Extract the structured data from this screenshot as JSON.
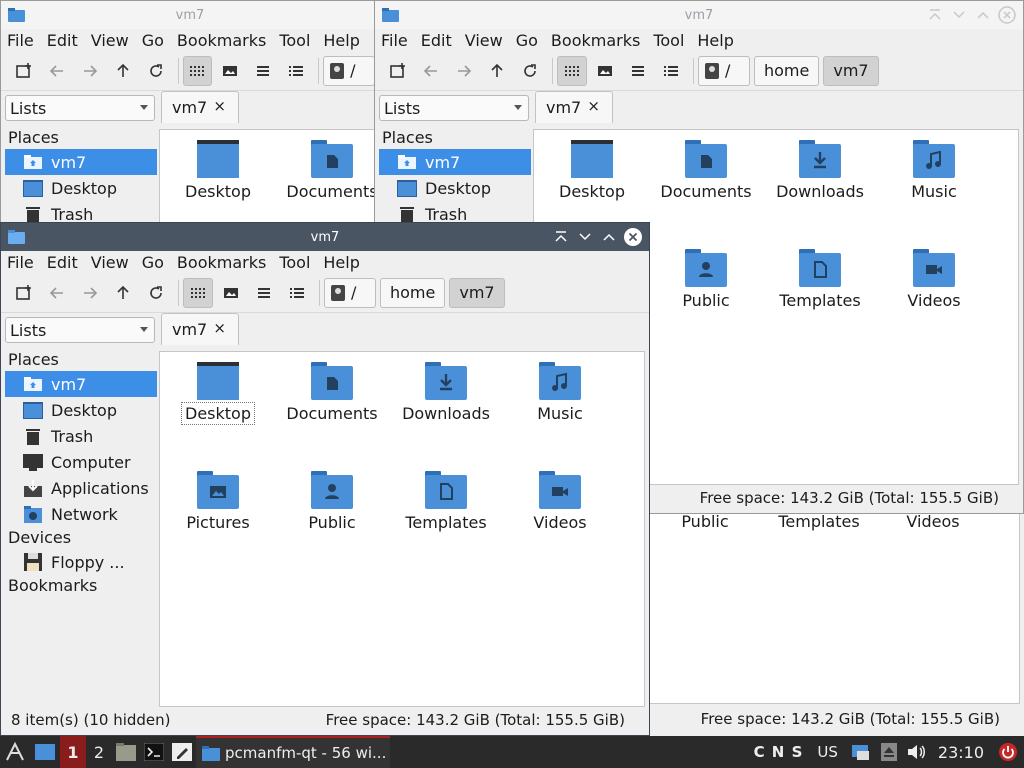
{
  "menu": [
    "File",
    "Edit",
    "View",
    "Go",
    "Bookmarks",
    "Tool",
    "Help"
  ],
  "breadcrumb": {
    "root": "/",
    "home": "home",
    "current": "vm7"
  },
  "side": {
    "combo": "Lists",
    "places_header": "Places",
    "devices_header": "Devices",
    "bookmarks_header": "Bookmarks",
    "places": [
      {
        "label": "vm7",
        "icon": "home-folder-icon"
      },
      {
        "label": "Desktop",
        "icon": "desktop-icon"
      },
      {
        "label": "Trash",
        "icon": "trash-icon"
      },
      {
        "label": "Computer",
        "icon": "computer-icon"
      },
      {
        "label": "Applications",
        "icon": "applications-icon"
      },
      {
        "label": "Network",
        "icon": "network-icon"
      }
    ],
    "devices": [
      {
        "label": "Floppy ...",
        "icon": "floppy-icon"
      }
    ]
  },
  "tab": {
    "label": "vm7",
    "close": "×"
  },
  "files": [
    {
      "label": "Desktop",
      "icon": "desktop-folder-icon"
    },
    {
      "label": "Documents",
      "icon": "documents-folder-icon"
    },
    {
      "label": "Downloads",
      "icon": "downloads-folder-icon"
    },
    {
      "label": "Music",
      "icon": "music-folder-icon"
    },
    {
      "label": "Pictures",
      "icon": "pictures-folder-icon"
    },
    {
      "label": "Public",
      "icon": "public-folder-icon"
    },
    {
      "label": "Templates",
      "icon": "templates-folder-icon"
    },
    {
      "label": "Videos",
      "icon": "videos-folder-icon"
    }
  ],
  "windows": {
    "w1": {
      "title": "vm7"
    },
    "w2": {
      "title": "vm7",
      "free_space": "Free space: 143.2 GiB (Total: 155.5 GiB)"
    },
    "w3": {
      "title": "vm7",
      "item_count": "8 item(s) (10 hidden)",
      "free_space": "Free space: 143.2 GiB (Total: 155.5 GiB)"
    }
  },
  "background_status": {
    "free_space": "Free space: 143.2 GiB (Total: 155.5 GiB)"
  },
  "taskbar": {
    "desktop1": "1",
    "desktop2": "2",
    "task_label": "pcmanfm-qt - 56 wi...",
    "keyboard": "C N S",
    "layout": "US",
    "clock": "23:10"
  },
  "colors": {
    "folder": "#4a90d9",
    "folder_dark": "#2f6fb5",
    "selection": "#3d8ee6",
    "titlebar_active": "#4a5563",
    "taskbar": "#2a2a2a",
    "desktop_active": "#8b1c1c"
  }
}
